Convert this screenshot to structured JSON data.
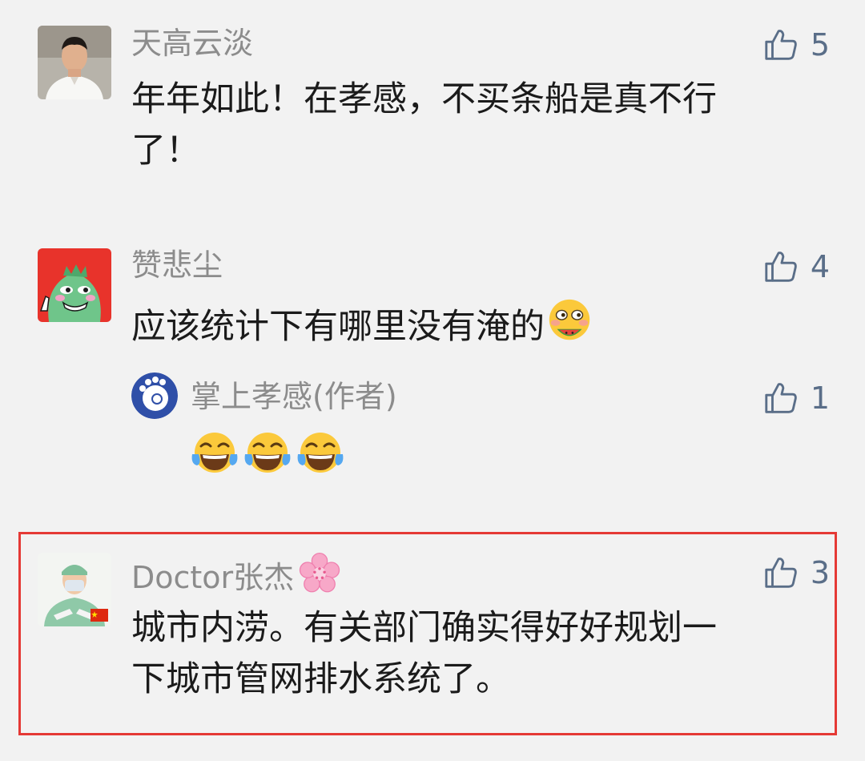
{
  "comments": [
    {
      "nickname": "天高云淡",
      "likes": "5",
      "text_line1": "年年如此！在孝感，不买条船是真不行",
      "text_line2": "了！",
      "avatar": "man-in-white-shirt-avatar"
    },
    {
      "nickname": "赞悲尘",
      "likes": "4",
      "text": "应该统计下有哪里没有淹的",
      "text_emoji": "face-eating-watermelon-emoji",
      "avatar": "green-dinosaur-avatar",
      "reply": {
        "nickname": "掌上孝感(作者)",
        "likes": "1",
        "emojis": [
          "tears-of-joy-emoji",
          "tears-of-joy-emoji",
          "tears-of-joy-emoji"
        ],
        "avatar": "zhangshang-xiaogan-logo"
      }
    },
    {
      "nickname": "Doctor张杰",
      "nickname_emoji": "cherry-blossom-emoji",
      "likes": "3",
      "text_line1": "城市内涝。有关部门确实得好好规划一",
      "text_line2": "下城市管网排水系统了。",
      "avatar": "doctor-in-scrubs-avatar",
      "highlighted": true
    }
  ],
  "icons": {
    "like": "thumbs-up-outline-icon"
  },
  "colors": {
    "background": "#f2f2f2",
    "nickname": "#8c8c8c",
    "like": "#5a6e88",
    "highlight": "#e53935"
  }
}
